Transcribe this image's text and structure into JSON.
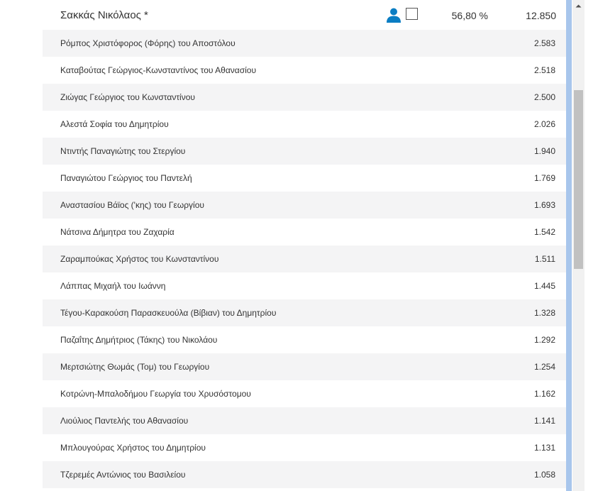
{
  "leader": {
    "name": "Σακκάς Νικόλαος *",
    "percent": "56,80 %",
    "votes": "12.850"
  },
  "candidates": [
    {
      "name": "Ρόμπος Χριστόφορος (Φόρης) του Αποστόλου",
      "votes": "2.583"
    },
    {
      "name": "Καταβούτας Γεώργιος-Κωνσταντίνος του Αθανασίου",
      "votes": "2.518"
    },
    {
      "name": "Ζιώγας Γεώργιος του Κωνσταντίνου",
      "votes": "2.500"
    },
    {
      "name": "Αλεστά Σοφία του Δημητρίου",
      "votes": "2.026"
    },
    {
      "name": "Ντιντής Παναγιώτης του Στεργίου",
      "votes": "1.940"
    },
    {
      "name": "Παναγιώτου Γεώργιος του Παντελή",
      "votes": "1.769"
    },
    {
      "name": "Αναστασίου Βάϊος ('κης) του Γεωργίου",
      "votes": "1.693"
    },
    {
      "name": "Νάτσινα Δήμητρα του Ζαχαρία",
      "votes": "1.542"
    },
    {
      "name": "Ζαραμπούκας Χρήστος του Κωνσταντίνου",
      "votes": "1.511"
    },
    {
      "name": "Λάππας Μιχαήλ του Ιωάννη",
      "votes": "1.445"
    },
    {
      "name": "Τέγου-Καρακούση Παρασκευούλα (Βίβιαν) του Δημητρίου",
      "votes": "1.328"
    },
    {
      "name": "Παζαΐτης Δημήτριος (Τάκης) του Νικολάου",
      "votes": "1.292"
    },
    {
      "name": "Μερτσιώτης Θωμάς (Τομ) του Γεωργίου",
      "votes": "1.254"
    },
    {
      "name": "Κοτρώνη-Μπαλοδήμου Γεωργία του Χρυσόστομου",
      "votes": "1.162"
    },
    {
      "name": "Λιούλιος Παντελής του Αθανασίου",
      "votes": "1.141"
    },
    {
      "name": "Μπλουγούρας Χρήστος του Δημητρίου",
      "votes": "1.131"
    },
    {
      "name": "Τζερεμές Αντώνιος του Βασιλείου",
      "votes": "1.058"
    }
  ],
  "icons": {
    "person": "person-icon",
    "checkbox": "checkbox-icon",
    "scroll_up": "chevron-up-icon"
  },
  "colors": {
    "person_icon": "#0a7dc3",
    "accent_bar": "#a8c6ec",
    "row_alt": "#f4f4f5"
  }
}
